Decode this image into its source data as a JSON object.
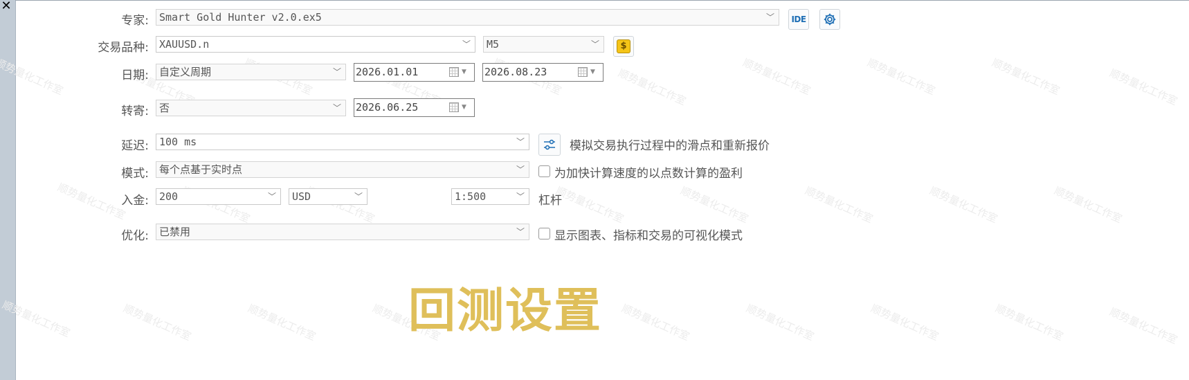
{
  "window": {
    "close_glyph": "✕"
  },
  "watermark": "顺势量化工作室",
  "colors": {
    "accent_blue": "#1f6fb5",
    "dollar_icon_bg": "#f5c518",
    "headline": "#dfbf5a"
  },
  "expert": {
    "label": "专家:",
    "value": "Smart Gold Hunter v2.0.ex5",
    "ide_label": "IDE",
    "settings_icon": "gear-icon"
  },
  "symbol": {
    "label": "交易品种:",
    "value": "XAUUSD.n",
    "timeframe": "M5",
    "symbol_icon": "dollar-icon"
  },
  "date": {
    "label": "日期:",
    "period": "自定义周期",
    "from": "2026.01.01",
    "to": "2026.08.23"
  },
  "forward": {
    "label": "转寄:",
    "value": "否",
    "date": "2026.06.25"
  },
  "delay": {
    "label": "延迟:",
    "value": "100 ms",
    "settings_icon": "sliders-icon",
    "note": "模拟交易执行过程中的滑点和重新报价"
  },
  "mode": {
    "label": "模式:",
    "value": "每个点基于实时点",
    "checkbox_label": "为加快计算速度的以点数计算的盈利",
    "checked": false
  },
  "deposit": {
    "label": "入金:",
    "amount": "200",
    "currency": "USD",
    "leverage": "1:500",
    "leverage_label": "杠杆"
  },
  "optimization": {
    "label": "优化:",
    "value": "已禁用",
    "checkbox_label": "显示图表、指标和交易的可视化模式",
    "checked": false
  },
  "headline": "回测设置"
}
